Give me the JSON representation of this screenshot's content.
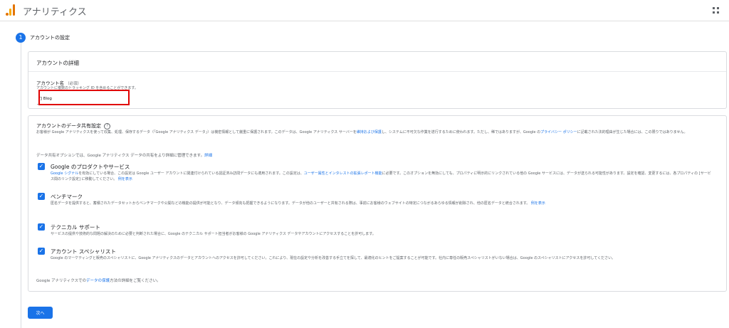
{
  "app": {
    "title": "アナリティクス"
  },
  "step": {
    "number": "1",
    "title": "アカウントの設定"
  },
  "account_details": {
    "heading": "アカウントの詳細",
    "name_label": "アカウント名",
    "required": "（必須）",
    "hint": "アカウントに複数のトラッキング ID を含めることができます。",
    "name_value": "TJ Blog"
  },
  "sharing": {
    "title": "アカウントのデータ共有設定",
    "help": "?",
    "desc_1": "お客様が Google アナリティクスを使って収集、処理、保存するデータ（「Google アナリティクス データ」）は機密情報として厳重に保護されます。このデータは、Google アナリティクス サーバーを",
    "desc_link_1": "維持および保護",
    "desc_2": "し、システムに不可欠な作業を遂行するために使われます。ただし、稀ではありますが、Google の",
    "desc_link_2": "プライバシー ポリシー",
    "desc_3": "に記載された法的理由が生じた場合には、この限りではありません。",
    "intro": "データ共有オプションでは、Google アナリティクス データの共有をより詳細に管理できます。",
    "intro_link": "詳細",
    "options": [
      {
        "title": "Google のプロダクトやサービス",
        "link_a": "Google シグナル",
        "text_a": "を有効にしている場合、この設定は Google ユーザー アカウントに関連付けられている認証済み訪問データにも適用されます。この設定は、",
        "link_b": "ユーザー属性とインタレストの拡張レポート機能",
        "text_b": "に必要です。このオプションを無効にしても、プロパティに明示的にリンクされている他の Google サービスには、データが送られる可能性があります。設定を確認、変更するには、各プロパティの [サービス間のリンク設定] に移動してください。",
        "link_c": "例を表示"
      },
      {
        "title": "ベンチマーク",
        "text_a": "匿名データを提供すると、蓄積されたデータセットからベンチマークや公開などの機能の提供が可能となり、データ傾向も把握できるようになります。データが他のユーザーと共有される際は、事前にお客様のウェブサイトの特定につながるあらゆる情報が削除され、他の匿名データと統合されます。",
        "link_c": "例を表示"
      },
      {
        "title": "テクニカル サポート",
        "text_a": "サービスの提供や技術的な問題の解決のために必要と判断された場合に、Google のテクニカル サポート担当者がお客様の Google アナリティクス データやアカウントにアクセスすることを許可します。"
      },
      {
        "title": "アカウント スペシャリスト",
        "text_a": "Google のマーケティングと販売のスペシャリストに、Google アナリティクスのデータとアカウントへのアクセスを許可してください。これにより、現在の設定や分析を改善する手立てを探して、最適化のヒントをご提案することが可能です。社内に専任の販売スペシャリストがいない場合は、Google のスペシャリストにアクセスを許可してください。"
      }
    ],
    "footer_1": "Google アナリティクスでの",
    "footer_link": "データの保護",
    "footer_2": "方法の詳細をご覧ください。"
  },
  "next_button": "次へ",
  "colors": {
    "accent": "#1a73e8",
    "highlight": "#e00000"
  }
}
